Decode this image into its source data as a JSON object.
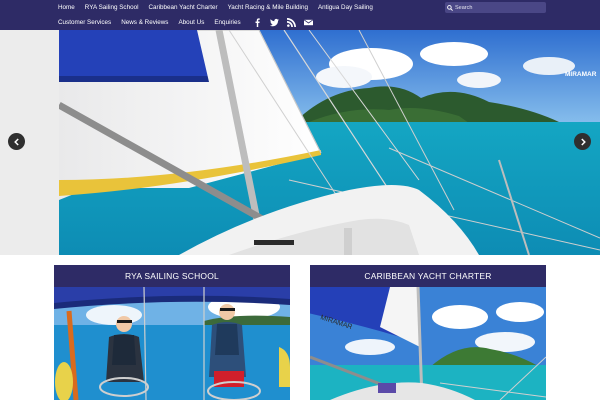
{
  "nav": {
    "row1": [
      "Home",
      "RYA Sailing School",
      "Caribbean Yacht Charter",
      "Yacht Racing & Mile Building",
      "Antigua Day Sailing"
    ],
    "row2": [
      "Customer Services",
      "News & Reviews",
      "About Us",
      "Enquiries"
    ],
    "social_icons": [
      "facebook-icon",
      "twitter-icon",
      "rss-icon",
      "email-icon"
    ]
  },
  "search": {
    "placeholder": "Search"
  },
  "hero": {
    "watermark": "MIRAMAR",
    "prev_icon": "chevron-left-icon",
    "next_icon": "chevron-right-icon"
  },
  "cards": [
    {
      "title": "RYA SAILING SCHOOL"
    },
    {
      "title": "CARIBBEAN YACHT CHARTER",
      "sail_text": "MIRAMAR"
    }
  ],
  "colors": {
    "nav_bg": "#2e2b66",
    "sea": "#1fb3c4",
    "sail_blue": "#2340b8"
  }
}
